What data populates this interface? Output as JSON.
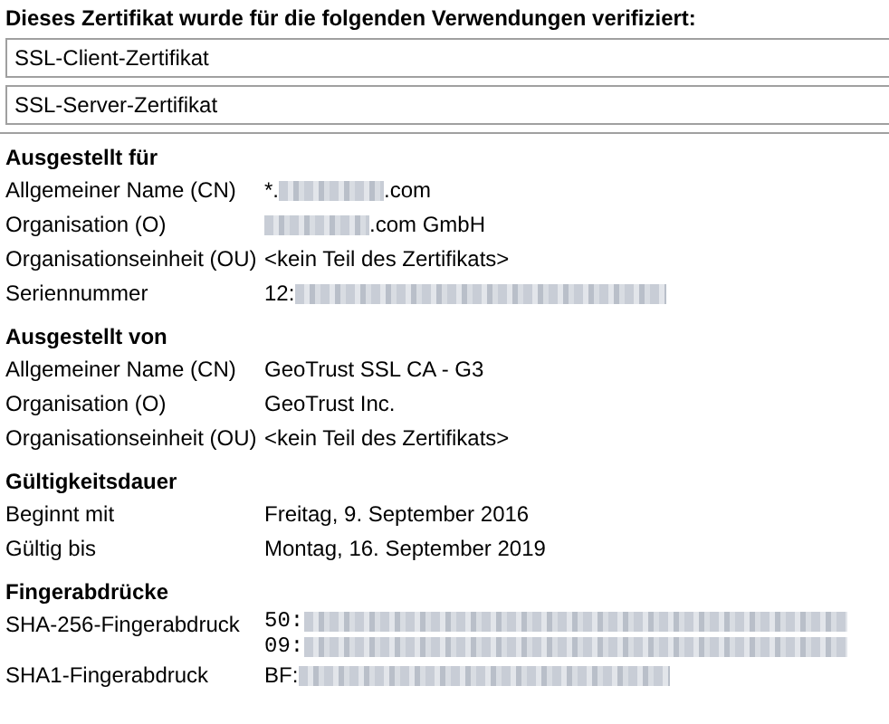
{
  "purposes_heading": "Dieses Zertifikat wurde für die folgenden Verwendungen verifiziert:",
  "purposes": [
    "SSL-Client-Zertifikat",
    "SSL-Server-Zertifikat"
  ],
  "sections": [
    {
      "title": "Ausgestellt für",
      "rows": [
        {
          "label": "Allgemeiner Name (CN)",
          "lines": [
            [
              {
                "kind": "text",
                "text": "*."
              },
              {
                "kind": "blur-medium"
              },
              {
                "kind": "text",
                "text": ".com"
              }
            ]
          ]
        },
        {
          "label": "Organisation (O)",
          "lines": [
            [
              {
                "kind": "blur-medium"
              },
              {
                "kind": "text",
                "text": ".com GmbH"
              }
            ]
          ]
        },
        {
          "label": "Organisationseinheit (OU)",
          "lines": [
            [
              {
                "kind": "text",
                "text": "<kein Teil des Zertifikats>"
              }
            ]
          ]
        },
        {
          "label": "Seriennummer",
          "lines": [
            [
              {
                "kind": "text",
                "text": "12:"
              },
              {
                "kind": "blur-long"
              }
            ]
          ]
        }
      ]
    },
    {
      "title": "Ausgestellt von",
      "rows": [
        {
          "label": "Allgemeiner Name (CN)",
          "lines": [
            [
              {
                "kind": "text",
                "text": "GeoTrust SSL CA - G3"
              }
            ]
          ]
        },
        {
          "label": "Organisation (O)",
          "lines": [
            [
              {
                "kind": "text",
                "text": "GeoTrust Inc."
              }
            ]
          ]
        },
        {
          "label": "Organisationseinheit (OU)",
          "lines": [
            [
              {
                "kind": "text",
                "text": "<kein Teil des Zertifikats>"
              }
            ]
          ]
        }
      ]
    },
    {
      "title": "Gültigkeitsdauer",
      "rows": [
        {
          "label": "Beginnt mit",
          "lines": [
            [
              {
                "kind": "text",
                "text": "Freitag, 9. September 2016"
              }
            ]
          ]
        },
        {
          "label": "Gültig bis",
          "lines": [
            [
              {
                "kind": "text",
                "text": "Montag, 16. September 2019"
              }
            ]
          ]
        }
      ]
    },
    {
      "title": "Fingerabdrücke",
      "rows": [
        {
          "label": "SHA-256-Fingerabdruck",
          "mono": true,
          "lines": [
            [
              {
                "kind": "text",
                "text": "50:"
              },
              {
                "kind": "blur-full"
              }
            ],
            [
              {
                "kind": "text",
                "text": "09:"
              },
              {
                "kind": "blur-full"
              }
            ]
          ]
        },
        {
          "label": "SHA1-Fingerabdruck",
          "lines": [
            [
              {
                "kind": "text",
                "text": "BF:"
              },
              {
                "kind": "blur-long"
              }
            ]
          ]
        }
      ]
    }
  ]
}
